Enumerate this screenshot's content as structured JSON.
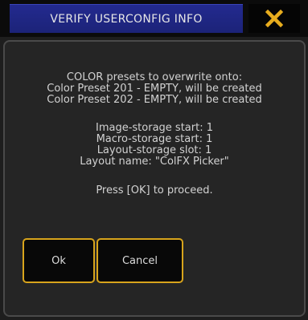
{
  "dialog": {
    "title": "VERIFY USERCONFIG INFO",
    "close_icon": "close-x-icon",
    "accent_color": "#d8a41c",
    "title_color": "#232a8f"
  },
  "message": {
    "header": "COLOR presets to overwrite onto:",
    "preset_1": "Color Preset 201 - EMPTY, will be created",
    "preset_2": "Color Preset 202 - EMPTY, will be created",
    "image_storage": "Image-storage start: 1",
    "macro_storage": "Macro-storage start: 1",
    "layout_slot": "Layout-storage slot: 1",
    "layout_name": "Layout name: \"ColFX Picker\"",
    "prompt": "Press [OK] to proceed."
  },
  "buttons": {
    "ok_label": "Ok",
    "cancel_label": "Cancel"
  }
}
